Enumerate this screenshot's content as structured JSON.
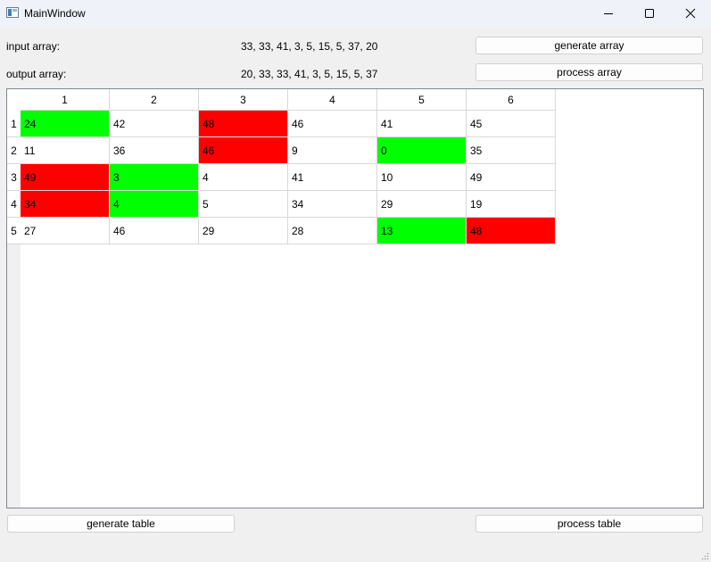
{
  "window": {
    "title": "MainWindow",
    "icons": {
      "app": "app-window-icon",
      "minimize": "minimize-icon",
      "maximize": "maximize-icon",
      "close": "close-icon"
    }
  },
  "input_array": {
    "label": "input array:",
    "value": "33, 33, 41, 3, 5, 15, 5, 37, 20"
  },
  "output_array": {
    "label": "output array:",
    "value": "20, 33, 33, 41, 3, 5, 15, 5, 37"
  },
  "buttons": {
    "generate_array": "generate array",
    "process_array": "process array",
    "generate_table": "generate table",
    "process_table": "process table"
  },
  "table": {
    "columns": [
      "1",
      "2",
      "3",
      "4",
      "5",
      "6"
    ],
    "rows": [
      {
        "header": "1",
        "cells": [
          "24",
          "42",
          "48",
          "46",
          "41",
          "45"
        ],
        "highlights": [
          "green",
          "",
          "red",
          "",
          "",
          ""
        ]
      },
      {
        "header": "2",
        "cells": [
          "11",
          "36",
          "46",
          "9",
          "0",
          "35"
        ],
        "highlights": [
          "",
          "",
          "red",
          "",
          "green",
          ""
        ]
      },
      {
        "header": "3",
        "cells": [
          "49",
          "3",
          "4",
          "41",
          "10",
          "49"
        ],
        "highlights": [
          "red",
          "green",
          "",
          "",
          "",
          ""
        ]
      },
      {
        "header": "4",
        "cells": [
          "34",
          "4",
          "5",
          "34",
          "29",
          "19"
        ],
        "highlights": [
          "red",
          "green",
          "",
          "",
          "",
          ""
        ]
      },
      {
        "header": "5",
        "cells": [
          "27",
          "46",
          "29",
          "28",
          "13",
          "48"
        ],
        "highlights": [
          "",
          "",
          "",
          "",
          "green",
          "red"
        ]
      }
    ]
  },
  "colors": {
    "green": "#00ff00",
    "red": "#ff0000",
    "window_bg": "#f0f0f0",
    "titlebar_bg": "#eff3f9"
  }
}
